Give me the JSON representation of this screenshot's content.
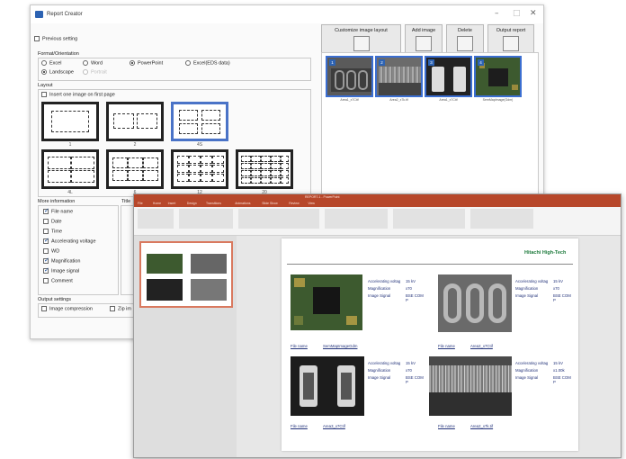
{
  "report_creator": {
    "title": "Report Creator",
    "previous_setting": "Previous setting",
    "format_label": "Format/Orientation",
    "formats": [
      "Excel",
      "Word",
      "PowerPoint",
      "Excel(EDS data)"
    ],
    "orientations": [
      "Landscape",
      "Portrait"
    ],
    "layout_label": "Layout",
    "insert_first_page": "Insert one image on first page",
    "layouts": [
      "1",
      "2",
      "4S",
      "4L",
      "6",
      "12",
      "20"
    ],
    "more_info_label": "More information",
    "info_items": [
      {
        "label": "File name",
        "checked": true
      },
      {
        "label": "Date",
        "checked": false
      },
      {
        "label": "Time",
        "checked": false
      },
      {
        "label": "Accelerating voltage",
        "checked": true
      },
      {
        "label": "WD",
        "checked": false
      },
      {
        "label": "Magnification",
        "checked": true
      },
      {
        "label": "Image signal",
        "checked": true
      },
      {
        "label": "Comment",
        "checked": false
      }
    ],
    "title_partial": "Title",
    "output_settings": "Output settings",
    "image_compression": "Image compression",
    "zip_partial": "Zip im",
    "toolbar": {
      "customize": "Customize image layout",
      "add_image": "Add image",
      "delete": "Delete",
      "output_report": "Output report"
    },
    "thumbnails": [
      {
        "num": "1",
        "caption": "Area1_x7Ctif"
      },
      {
        "num": "2",
        "caption": "Area2_x7k.tif"
      },
      {
        "num": "3",
        "caption": "Area1_x7Ctif"
      },
      {
        "num": "4",
        "caption": "SemMapImage(Gdm)"
      }
    ]
  },
  "powerpoint": {
    "title": "REPORT-1 - PowerPoint",
    "tabs": [
      "File",
      "Home",
      "Insert",
      "Design",
      "Transitions",
      "Animations",
      "Slide Show",
      "Review",
      "View"
    ],
    "brand": "Hitachi High-Tech",
    "panels": [
      {
        "meta": [
          [
            "Accelerating voltag",
            "15 kV"
          ],
          [
            "Magnification",
            "x70"
          ],
          [
            "Image Signal",
            "BSE COM P"
          ]
        ],
        "file_label": "File name",
        "file_value": "SemMapImageGdm"
      },
      {
        "meta": [
          [
            "Accelerating voltag",
            "15 kV"
          ],
          [
            "Magnification",
            "x70"
          ],
          [
            "Image Signal",
            "BSE COM P"
          ]
        ],
        "file_label": "File name",
        "file_value": "Area2_x7Ctif"
      },
      {
        "meta": [
          [
            "Accelerating voltag",
            "15 kV"
          ],
          [
            "Magnification",
            "x70"
          ],
          [
            "Image Signal",
            "BSE COM P"
          ]
        ],
        "file_label": "File name",
        "file_value": "Area3_x7Ctif"
      },
      {
        "meta": [
          [
            "Accelerating voltag",
            "15 kV"
          ],
          [
            "Magnification",
            "x1.00k"
          ],
          [
            "Image Signal",
            "BSE COM P"
          ]
        ],
        "file_label": "File name",
        "file_value": "Area2_x7k.tif"
      }
    ]
  }
}
